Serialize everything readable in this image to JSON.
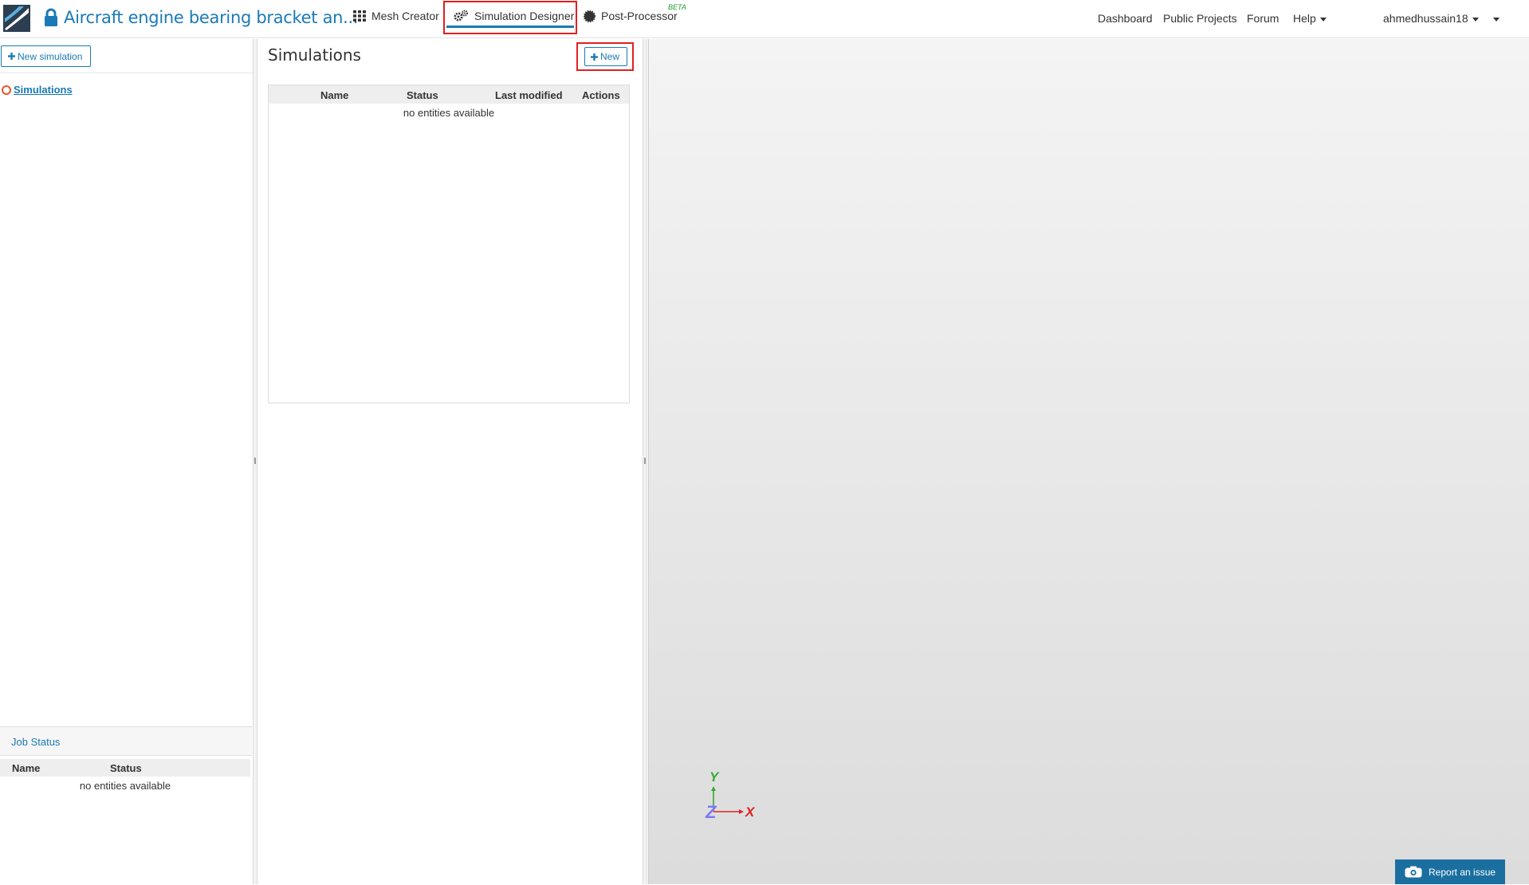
{
  "header": {
    "project_title": "Aircraft engine bearing bracket an...",
    "nav": [
      {
        "label": "Mesh Creator",
        "icon": "grid-icon"
      },
      {
        "label": "Simulation Designer",
        "icon": "gears-icon",
        "active": true
      },
      {
        "label": "Post-Processor",
        "icon": "post-processor-icon",
        "badge": "BETA"
      }
    ],
    "right_links": {
      "dashboard": "Dashboard",
      "public_projects": "Public Projects",
      "forum": "Forum",
      "help": "Help",
      "user": "ahmedhussain18"
    }
  },
  "sidebar": {
    "new_simulation_label": "New simulation",
    "tree_item_label": "Simulations",
    "job_status": {
      "title": "Job Status",
      "columns": [
        "Name",
        "Status"
      ],
      "empty_text": "no entities available"
    }
  },
  "simulations_panel": {
    "title": "Simulations",
    "new_button_label": "New",
    "columns": [
      "Name",
      "Status",
      "Last modified",
      "Actions"
    ],
    "empty_text": "no entities available"
  },
  "viewport": {
    "axes": {
      "x": "X",
      "y": "Y",
      "z": "Z"
    },
    "report_issue_label": "Report an issue"
  },
  "colors": {
    "accent": "#1a7ab5",
    "highlight": "#e02020",
    "tree_status": "#e8562a",
    "axis_x": "#e02020",
    "axis_y": "#33aa33",
    "axis_z": "#7b7bf0"
  }
}
